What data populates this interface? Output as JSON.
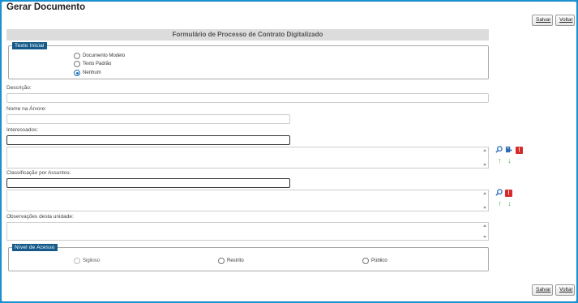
{
  "page": {
    "title": "Gerar Documento"
  },
  "toolbar": {
    "save_label": "Salvar",
    "back_label": "Voltar"
  },
  "form": {
    "header": "Formulário de Processo de Contrato Digitalizado",
    "texto_inicial": {
      "legend": "Texto Inicial",
      "options": [
        {
          "label": "Documento Modelo",
          "checked": false
        },
        {
          "label": "Texto Padrão",
          "checked": false
        },
        {
          "label": "Nenhum",
          "checked": true
        }
      ]
    },
    "descricao": {
      "label": "Descrição:",
      "value": ""
    },
    "nome_arvore": {
      "label": "Nome na Árvore:",
      "value": ""
    },
    "interessados": {
      "label": "Interessados:",
      "value": ""
    },
    "classificacao": {
      "label": "Classificação por Assuntos:",
      "value": ""
    },
    "observacoes": {
      "label": "Observações desta unidade:",
      "value": ""
    },
    "nivel_acesso": {
      "legend": "Nível de Acesso",
      "options": [
        {
          "label": "Sigiloso",
          "checked": false,
          "disabled": true
        },
        {
          "label": "Restrito",
          "checked": false,
          "disabled": false
        },
        {
          "label": "Público",
          "checked": false,
          "disabled": false
        }
      ]
    }
  },
  "icons": {
    "search": "search-icon",
    "new_contact": "new-contact-icon",
    "remove": "remove-icon",
    "move_up": "arrow-up-icon",
    "move_down": "arrow-down-icon"
  },
  "colors": {
    "frame_border": "#1a8fd1",
    "legend_bg": "#155a8a",
    "remove_red": "#d62b2b",
    "arrow_green": "#3cb043",
    "radio_checked": "#1a6fb5"
  }
}
